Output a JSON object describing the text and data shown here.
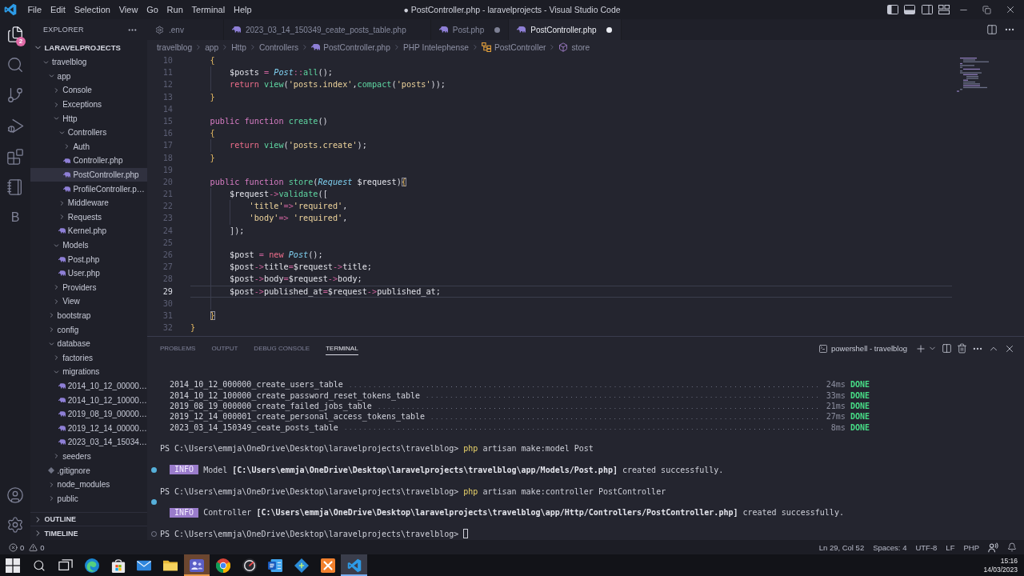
{
  "title_bar": {
    "menu": [
      "File",
      "Edit",
      "Selection",
      "View",
      "Go",
      "Run",
      "Terminal",
      "Help"
    ],
    "title": "● PostController.php - laravelprojects - Visual Studio Code"
  },
  "activity_bar": {
    "items": [
      {
        "kind": "explorer",
        "selected": true,
        "badge": "2"
      },
      {
        "kind": "search",
        "selected": false
      },
      {
        "kind": "source_control",
        "selected": false
      },
      {
        "kind": "run_debug",
        "selected": false
      },
      {
        "kind": "extensions",
        "selected": false
      },
      {
        "kind": "notebook",
        "selected": false
      },
      {
        "kind": "letter",
        "label": "B",
        "selected": false
      }
    ],
    "bottom": [
      {
        "kind": "account"
      },
      {
        "kind": "settings"
      }
    ]
  },
  "sidebar": {
    "title": "EXPLORER",
    "root": {
      "label": "LARAVELPROJECTS",
      "expanded": true
    },
    "tree": [
      {
        "label": "travelblog",
        "kind": "folder",
        "expanded": true,
        "selected": false,
        "children": [
          {
            "label": "app",
            "kind": "folder",
            "expanded": true,
            "selected": false,
            "children": [
              {
                "label": "Console",
                "kind": "folder",
                "expanded": false,
                "selected": false
              },
              {
                "label": "Exceptions",
                "kind": "folder",
                "expanded": false,
                "selected": false
              },
              {
                "label": "Http",
                "kind": "folder",
                "expanded": true,
                "selected": false,
                "children": [
                  {
                    "label": "Controllers",
                    "kind": "folder",
                    "expanded": true,
                    "selected": false,
                    "children": [
                      {
                        "label": "Auth",
                        "kind": "folder",
                        "expanded": false,
                        "selected": false
                      },
                      {
                        "label": "Controller.php",
                        "kind": "php",
                        "selected": false
                      },
                      {
                        "label": "PostController.php",
                        "kind": "php",
                        "selected": true
                      },
                      {
                        "label": "ProfileController.p…",
                        "kind": "php",
                        "selected": false
                      }
                    ]
                  },
                  {
                    "label": "Middleware",
                    "kind": "folder",
                    "expanded": false,
                    "selected": false
                  },
                  {
                    "label": "Requests",
                    "kind": "folder",
                    "expanded": false,
                    "selected": false
                  },
                  {
                    "label": "Kernel.php",
                    "kind": "php",
                    "selected": false
                  }
                ]
              },
              {
                "label": "Models",
                "kind": "folder",
                "expanded": true,
                "selected": false,
                "children": [
                  {
                    "label": "Post.php",
                    "kind": "php",
                    "selected": false
                  },
                  {
                    "label": "User.php",
                    "kind": "php",
                    "selected": false
                  }
                ]
              },
              {
                "label": "Providers",
                "kind": "folder",
                "expanded": false,
                "selected": false
              },
              {
                "label": "View",
                "kind": "folder",
                "expanded": false,
                "selected": false
              }
            ]
          },
          {
            "label": "bootstrap",
            "kind": "folder",
            "expanded": false,
            "selected": false
          },
          {
            "label": "config",
            "kind": "folder",
            "expanded": false,
            "selected": false
          },
          {
            "label": "database",
            "kind": "folder",
            "expanded": true,
            "selected": false,
            "children": [
              {
                "label": "factories",
                "kind": "folder",
                "expanded": false,
                "selected": false
              },
              {
                "label": "migrations",
                "kind": "folder",
                "expanded": true,
                "selected": false,
                "children": [
                  {
                    "label": "2014_10_12_00000…",
                    "kind": "php",
                    "selected": false
                  },
                  {
                    "label": "2014_10_12_10000…",
                    "kind": "php",
                    "selected": false
                  },
                  {
                    "label": "2019_08_19_00000…",
                    "kind": "php",
                    "selected": false
                  },
                  {
                    "label": "2019_12_14_00000…",
                    "kind": "php",
                    "selected": false
                  },
                  {
                    "label": "2023_03_14_15034…",
                    "kind": "php",
                    "selected": false
                  }
                ]
              },
              {
                "label": "seeders",
                "kind": "folder",
                "expanded": false,
                "selected": false
              }
            ]
          },
          {
            "label": ".gitignore",
            "kind": "gitignore",
            "selected": false
          },
          {
            "label": "node_modules",
            "kind": "folder",
            "expanded": false,
            "selected": false
          },
          {
            "label": "public",
            "kind": "folder",
            "expanded": false,
            "selected": false
          }
        ]
      }
    ],
    "sections": [
      {
        "label": "OUTLINE",
        "expanded": false
      },
      {
        "label": "TIMELINE",
        "expanded": false
      }
    ]
  },
  "editor": {
    "tabs": [
      {
        "label": ".env",
        "kind": "config",
        "selected": false,
        "modified": false
      },
      {
        "label": "2023_03_14_150349_ceate_posts_table.php",
        "kind": "php",
        "selected": false,
        "modified": false
      },
      {
        "label": "Post.php",
        "kind": "php",
        "selected": false,
        "modified": true
      },
      {
        "label": "PostController.php",
        "kind": "php",
        "selected": true,
        "modified": true
      }
    ],
    "breadcrumbs": [
      {
        "label": "travelblog",
        "kind": "plain"
      },
      {
        "label": "app",
        "kind": "plain"
      },
      {
        "label": "Http",
        "kind": "plain"
      },
      {
        "label": "Controllers",
        "kind": "plain"
      },
      {
        "label": "PostController.php",
        "kind": "php"
      },
      {
        "label": "PHP Intelephense",
        "kind": "plain"
      },
      {
        "label": "PostController",
        "kind": "class"
      },
      {
        "label": "store",
        "kind": "method"
      }
    ],
    "lines": [
      {
        "children": [
          {
            "number": "10",
            "current": false,
            "tokens": [
              {
                "text": "{",
                "kind": "brace"
              }
            ],
            "children": [
              {
                "number": "11",
                "current": false,
                "tokens": [
                  {
                    "text": "$posts",
                    "kind": "variable"
                  },
                  {
                    "text": " = ",
                    "kind": "operator"
                  },
                  {
                    "text": "Post",
                    "kind": "class"
                  },
                  {
                    "text": "::",
                    "kind": "operator"
                  },
                  {
                    "text": "all",
                    "kind": "function"
                  },
                  {
                    "text": "();",
                    "kind": "punct"
                  }
                ]
              },
              {
                "number": "12",
                "current": false,
                "tokens": [
                  {
                    "text": "return ",
                    "kind": "control"
                  },
                  {
                    "text": "view",
                    "kind": "function"
                  },
                  {
                    "text": "(",
                    "kind": "punct"
                  },
                  {
                    "text": "'posts.index'",
                    "kind": "string"
                  },
                  {
                    "text": ",",
                    "kind": "punct"
                  },
                  {
                    "text": "compact",
                    "kind": "function"
                  },
                  {
                    "text": "(",
                    "kind": "punct"
                  },
                  {
                    "text": "'posts'",
                    "kind": "string"
                  },
                  {
                    "text": "));",
                    "kind": "punct"
                  }
                ]
              }
            ]
          },
          {
            "number": "13",
            "current": false,
            "tokens": [
              {
                "text": "}",
                "kind": "brace"
              }
            ]
          },
          {
            "number": "14",
            "current": false
          },
          {
            "number": "15",
            "current": false,
            "tokens": [
              {
                "text": "public function ",
                "kind": "keyword"
              },
              {
                "text": "create",
                "kind": "function"
              },
              {
                "text": "()",
                "kind": "punct"
              }
            ]
          },
          {
            "number": "16",
            "current": false,
            "tokens": [
              {
                "text": "{",
                "kind": "brace"
              }
            ],
            "children": [
              {
                "number": "17",
                "current": false,
                "tokens": [
                  {
                    "text": "return ",
                    "kind": "control"
                  },
                  {
                    "text": "view",
                    "kind": "function"
                  },
                  {
                    "text": "(",
                    "kind": "punct"
                  },
                  {
                    "text": "'posts.create'",
                    "kind": "string"
                  },
                  {
                    "text": ");",
                    "kind": "punct"
                  }
                ]
              }
            ]
          },
          {
            "number": "18",
            "current": false,
            "tokens": [
              {
                "text": "}",
                "kind": "brace"
              }
            ]
          },
          {
            "number": "19",
            "current": false
          },
          {
            "number": "20",
            "current": false,
            "tokens": [
              {
                "text": "public function ",
                "kind": "keyword"
              },
              {
                "text": "store",
                "kind": "function"
              },
              {
                "text": "(",
                "kind": "punct"
              },
              {
                "text": "Request",
                "kind": "class"
              },
              {
                "text": " $request",
                "kind": "variable"
              },
              {
                "text": ")",
                "kind": "punct"
              },
              {
                "text": "{",
                "kind": "bracket_match"
              }
            ],
            "children": [
              {
                "number": "21",
                "current": false,
                "tokens": [
                  {
                    "text": "$request",
                    "kind": "variable"
                  },
                  {
                    "text": "->",
                    "kind": "operator"
                  },
                  {
                    "text": "validate",
                    "kind": "function"
                  },
                  {
                    "text": "([",
                    "kind": "punct"
                  }
                ],
                "children": [
                  {
                    "number": "22",
                    "current": false,
                    "tokens": [
                      {
                        "text": "'title'",
                        "kind": "string"
                      },
                      {
                        "text": "=>",
                        "kind": "operator"
                      },
                      {
                        "text": "'required'",
                        "kind": "string"
                      },
                      {
                        "text": ",",
                        "kind": "punct"
                      }
                    ]
                  },
                  {
                    "number": "23",
                    "current": false,
                    "tokens": [
                      {
                        "text": "'body'",
                        "kind": "string"
                      },
                      {
                        "text": "=> ",
                        "kind": "operator"
                      },
                      {
                        "text": "'required'",
                        "kind": "string"
                      },
                      {
                        "text": ",",
                        "kind": "punct"
                      }
                    ]
                  }
                ]
              },
              {
                "number": "24",
                "current": false,
                "tokens": [
                  {
                    "text": "]);",
                    "kind": "punct"
                  }
                ]
              },
              {
                "number": "25",
                "current": false
              },
              {
                "number": "26",
                "current": false,
                "tokens": [
                  {
                    "text": "$post",
                    "kind": "variable"
                  },
                  {
                    "text": " = ",
                    "kind": "operator"
                  },
                  {
                    "text": "new ",
                    "kind": "control"
                  },
                  {
                    "text": "Post",
                    "kind": "class"
                  },
                  {
                    "text": "();",
                    "kind": "punct"
                  }
                ]
              },
              {
                "number": "27",
                "current": false,
                "tokens": [
                  {
                    "text": "$post",
                    "kind": "variable"
                  },
                  {
                    "text": "->",
                    "kind": "operator"
                  },
                  {
                    "text": "title",
                    "kind": "property"
                  },
                  {
                    "text": "=",
                    "kind": "operator"
                  },
                  {
                    "text": "$request",
                    "kind": "variable"
                  },
                  {
                    "text": "->",
                    "kind": "operator"
                  },
                  {
                    "text": "title",
                    "kind": "property"
                  },
                  {
                    "text": ";",
                    "kind": "punct"
                  }
                ]
              },
              {
                "number": "28",
                "current": false,
                "tokens": [
                  {
                    "text": "$post",
                    "kind": "variable"
                  },
                  {
                    "text": "->",
                    "kind": "operator"
                  },
                  {
                    "text": "body",
                    "kind": "property"
                  },
                  {
                    "text": "=",
                    "kind": "operator"
                  },
                  {
                    "text": "$request",
                    "kind": "variable"
                  },
                  {
                    "text": "->",
                    "kind": "operator"
                  },
                  {
                    "text": "body",
                    "kind": "property"
                  },
                  {
                    "text": ";",
                    "kind": "punct"
                  }
                ]
              },
              {
                "number": "29",
                "current": true,
                "tokens": [
                  {
                    "text": "$post",
                    "kind": "variable"
                  },
                  {
                    "text": "->",
                    "kind": "operator"
                  },
                  {
                    "text": "published_at",
                    "kind": "property"
                  },
                  {
                    "text": "=",
                    "kind": "operator"
                  },
                  {
                    "text": "$request",
                    "kind": "variable"
                  },
                  {
                    "text": "->",
                    "kind": "operator"
                  },
                  {
                    "text": "published_at",
                    "kind": "property"
                  },
                  {
                    "text": ";",
                    "kind": "punct"
                  }
                ]
              },
              {
                "number": "30",
                "current": false
              }
            ]
          },
          {
            "number": "31",
            "current": false,
            "tokens": [
              {
                "text": "}",
                "kind": "bracket_match"
              }
            ]
          }
        ]
      },
      {
        "number": "32",
        "current": false,
        "tokens": [
          {
            "text": "}",
            "kind": "brace"
          }
        ]
      }
    ]
  },
  "panel": {
    "tabs": [
      {
        "label": "PROBLEMS",
        "selected": false
      },
      {
        "label": "OUTPUT",
        "selected": false
      },
      {
        "label": "DEBUG CONSOLE",
        "selected": false
      },
      {
        "label": "TERMINAL",
        "selected": true
      }
    ],
    "terminal_name": "powershell - travelblog",
    "lines": [
      {
        "kind": "migration",
        "name": "2014_10_12_000000_create_users_table",
        "duration": "24ms",
        "status": "DONE"
      },
      {
        "kind": "migration",
        "name": "2014_10_12_100000_create_password_reset_tokens_table",
        "duration": "33ms",
        "status": "DONE"
      },
      {
        "kind": "migration",
        "name": "2019_08_19_000000_create_failed_jobs_table",
        "duration": "21ms",
        "status": "DONE"
      },
      {
        "kind": "migration",
        "name": "2019_12_14_000001_create_personal_access_tokens_table",
        "duration": "27ms",
        "status": "DONE"
      },
      {
        "kind": "migration",
        "name": "2023_03_14_150349_ceate_posts_table",
        "duration": "8ms",
        "status": "DONE"
      },
      {
        "kind": "blank"
      },
      {
        "kind": "prompt",
        "prompt": "PS C:\\Users\\emmja\\OneDrive\\Desktop\\laravelprojects\\travelblog>",
        "command": "php",
        "args": "artisan make:model Post"
      },
      {
        "kind": "blank"
      },
      {
        "kind": "info",
        "badge": "INFO",
        "message": "Model **[C:\\Users\\emmja\\OneDrive\\Desktop\\laravelprojects\\travelblog\\app/Models/Post.php]** created successfully.",
        "decoration": {
          "kind": "success"
        }
      },
      {
        "kind": "blank"
      },
      {
        "kind": "prompt",
        "prompt": "PS C:\\Users\\emmja\\OneDrive\\Desktop\\laravelprojects\\travelblog>",
        "command": "php",
        "args": "artisan make:controller PostController"
      },
      {
        "kind": "blank",
        "decoration": {
          "kind": "success"
        }
      },
      {
        "kind": "info",
        "badge": "INFO",
        "message": "Controller **[C:\\Users\\emmja\\OneDrive\\Desktop\\laravelprojects\\travelblog\\app/Http/Controllers/PostController.php]** created successfully."
      },
      {
        "kind": "blank"
      },
      {
        "kind": "prompt",
        "prompt": "PS C:\\Users\\emmja\\OneDrive\\Desktop\\laravelprojects\\travelblog>",
        "cursor": true,
        "decoration": {
          "kind": "pending"
        }
      }
    ]
  },
  "status_bar": {
    "errors": "0",
    "warnings": "0",
    "items": [
      "Ln 29, Col 52",
      "Spaces: 4",
      "UTF-8",
      "LF",
      "PHP"
    ]
  },
  "taskbar": {
    "apps": [
      {
        "kind": "start",
        "selected": false,
        "attention": false
      },
      {
        "kind": "search",
        "selected": false,
        "attention": false
      },
      {
        "kind": "task_view",
        "selected": false,
        "attention": false
      },
      {
        "kind": "swirl",
        "selected": false,
        "attention": false
      },
      {
        "kind": "bag",
        "selected": false,
        "attention": false
      },
      {
        "kind": "mail",
        "selected": false,
        "attention": false
      },
      {
        "kind": "folder",
        "selected": false,
        "attention": false
      },
      {
        "kind": "people",
        "selected": false,
        "attention": true
      },
      {
        "kind": "ring",
        "selected": false,
        "attention": false
      },
      {
        "kind": "gauge",
        "selected": false,
        "attention": false
      },
      {
        "kind": "document",
        "selected": false,
        "attention": false
      },
      {
        "kind": "diamond",
        "selected": false,
        "attention": false
      },
      {
        "kind": "cross",
        "selected": false,
        "attention": false
      },
      {
        "kind": "code",
        "selected": true,
        "attention": false
      }
    ],
    "time": "15:16",
    "date": "14/03/2023"
  }
}
